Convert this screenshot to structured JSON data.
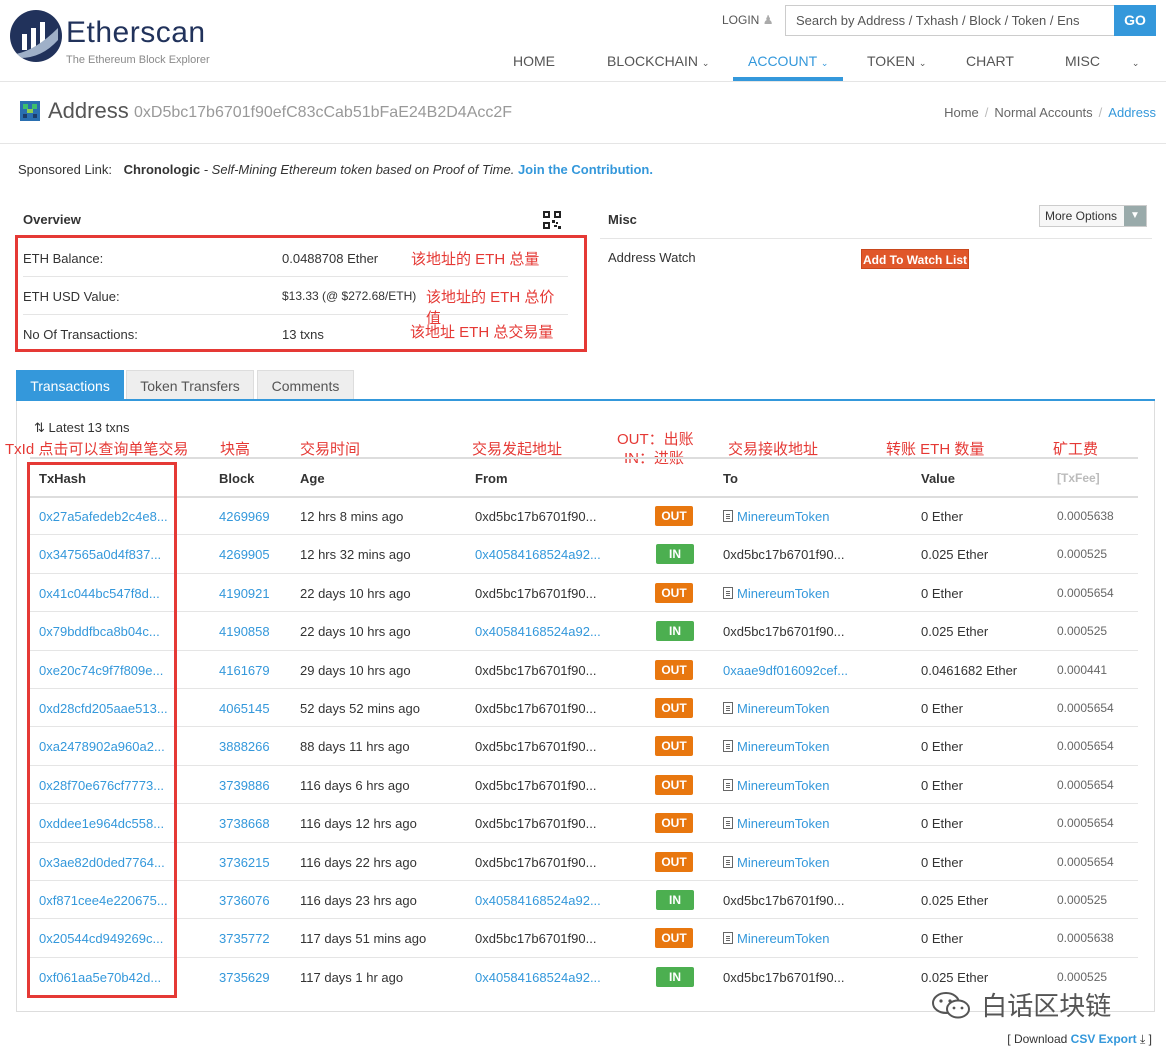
{
  "header": {
    "brand": "Etherscan",
    "tagline": "The Ethereum Block Explorer",
    "login": "LOGIN",
    "search_placeholder": "Search by Address / Txhash / Block / Token / Ens",
    "go": "GO",
    "nav": [
      "HOME",
      "BLOCKCHAIN",
      "ACCOUNT",
      "TOKEN",
      "CHART",
      "MISC"
    ],
    "active_nav": "ACCOUNT",
    "accent": "#3498db"
  },
  "title": {
    "label": "Address",
    "address": "0xD5bc17b6701f90efC83cCab51bFaE24B2D4Acc2F",
    "breadcrumb": [
      "Home",
      "Normal Accounts",
      "Address"
    ]
  },
  "sponsor": {
    "prefix": "Sponsored Link:",
    "name": "Chronologic",
    "desc": " - Self-Mining Ethereum token based on Proof of Time.",
    "cta": "Join the Contribution."
  },
  "overview": {
    "title": "Overview",
    "rows": [
      {
        "key": "ETH Balance:",
        "value": "0.0488708 Ether",
        "note": "该地址的 ETH 总量"
      },
      {
        "key": "ETH USD Value:",
        "value": "$13.33 (@ $272.68/ETH)",
        "note": "该地址的 ETH 总价值"
      },
      {
        "key": "No Of Transactions:",
        "value": "13 txns",
        "note": "该地址 ETH 总交易量"
      }
    ]
  },
  "misc": {
    "title": "Misc",
    "more_options": "More Options",
    "watch_label": "Address Watch",
    "watch_button": "Add To Watch List"
  },
  "tabs": [
    "Transactions",
    "Token Transfers",
    "Comments"
  ],
  "txns": {
    "latest": "Latest 13 txns",
    "cn_headers": [
      "TxId 点击可以查询单笔交易",
      "块高",
      "交易时间",
      "交易发起地址",
      "OUT：出账",
      "IN：进账",
      "交易接收地址",
      "转账 ETH 数量",
      "矿工费"
    ],
    "columns": [
      "TxHash",
      "Block",
      "Age",
      "From",
      "To",
      "Value",
      "[TxFee]"
    ],
    "rows": [
      {
        "hash": "0x27a5afedeb2c4e8...",
        "block": "4269969",
        "age": "12 hrs 8 mins ago",
        "from": "0xd5bc17b6701f90...",
        "dir": "OUT",
        "to": "MinereumToken",
        "value": "0 Ether",
        "fee": "0.0005638"
      },
      {
        "hash": "0x347565a0d4f837...",
        "block": "4269905",
        "age": "12 hrs 32 mins ago",
        "from": "0x40584168524a92...",
        "dir": "IN",
        "to": "0xd5bc17b6701f90...",
        "value": "0.025 Ether",
        "fee": "0.000525"
      },
      {
        "hash": "0x41c044bc547f8d...",
        "block": "4190921",
        "age": "22 days 10 hrs ago",
        "from": "0xd5bc17b6701f90...",
        "dir": "OUT",
        "to": "MinereumToken",
        "value": "0 Ether",
        "fee": "0.0005654"
      },
      {
        "hash": "0x79bddfbca8b04c...",
        "block": "4190858",
        "age": "22 days 10 hrs ago",
        "from": "0x40584168524a92...",
        "dir": "IN",
        "to": "0xd5bc17b6701f90...",
        "value": "0.025 Ether",
        "fee": "0.000525"
      },
      {
        "hash": "0xe20c74c9f7f809e...",
        "block": "4161679",
        "age": "29 days 10 hrs ago",
        "from": "0xd5bc17b6701f90...",
        "dir": "OUT",
        "to": "0xaae9df016092cef...",
        "value": "0.0461682 Ether",
        "fee": "0.000441"
      },
      {
        "hash": "0xd28cfd205aae513...",
        "block": "4065145",
        "age": "52 days 52 mins ago",
        "from": "0xd5bc17b6701f90...",
        "dir": "OUT",
        "to": "MinereumToken",
        "value": "0 Ether",
        "fee": "0.0005654"
      },
      {
        "hash": "0xa2478902a960a2...",
        "block": "3888266",
        "age": "88 days 11 hrs ago",
        "from": "0xd5bc17b6701f90...",
        "dir": "OUT",
        "to": "MinereumToken",
        "value": "0 Ether",
        "fee": "0.0005654"
      },
      {
        "hash": "0x28f70e676cf7773...",
        "block": "3739886",
        "age": "116 days 6 hrs ago",
        "from": "0xd5bc17b6701f90...",
        "dir": "OUT",
        "to": "MinereumToken",
        "value": "0 Ether",
        "fee": "0.0005654"
      },
      {
        "hash": "0xddee1e964dc558...",
        "block": "3738668",
        "age": "116 days 12 hrs ago",
        "from": "0xd5bc17b6701f90...",
        "dir": "OUT",
        "to": "MinereumToken",
        "value": "0 Ether",
        "fee": "0.0005654"
      },
      {
        "hash": "0x3ae82d0ded7764...",
        "block": "3736215",
        "age": "116 days 22 hrs ago",
        "from": "0xd5bc17b6701f90...",
        "dir": "OUT",
        "to": "MinereumToken",
        "value": "0 Ether",
        "fee": "0.0005654"
      },
      {
        "hash": "0xf871cee4e220675...",
        "block": "3736076",
        "age": "116 days 23 hrs ago",
        "from": "0x40584168524a92...",
        "dir": "IN",
        "to": "0xd5bc17b6701f90...",
        "value": "0.025 Ether",
        "fee": "0.000525"
      },
      {
        "hash": "0x20544cd949269c...",
        "block": "3735772",
        "age": "117 days 51 mins ago",
        "from": "0xd5bc17b6701f90...",
        "dir": "OUT",
        "to": "MinereumToken",
        "value": "0 Ether",
        "fee": "0.0005638"
      },
      {
        "hash": "0xf061aa5e70b42d...",
        "block": "3735629",
        "age": "117 days 1 hr ago",
        "from": "0x40584168524a92...",
        "dir": "IN",
        "to": "0xd5bc17b6701f90...",
        "value": "0.025 Ether",
        "fee": "0.000525"
      }
    ]
  },
  "footer": {
    "csv_prefix": "[ Download ",
    "csv_link": "CSV Export",
    "csv_suffix": " ]",
    "watermark": "白话区块链"
  }
}
